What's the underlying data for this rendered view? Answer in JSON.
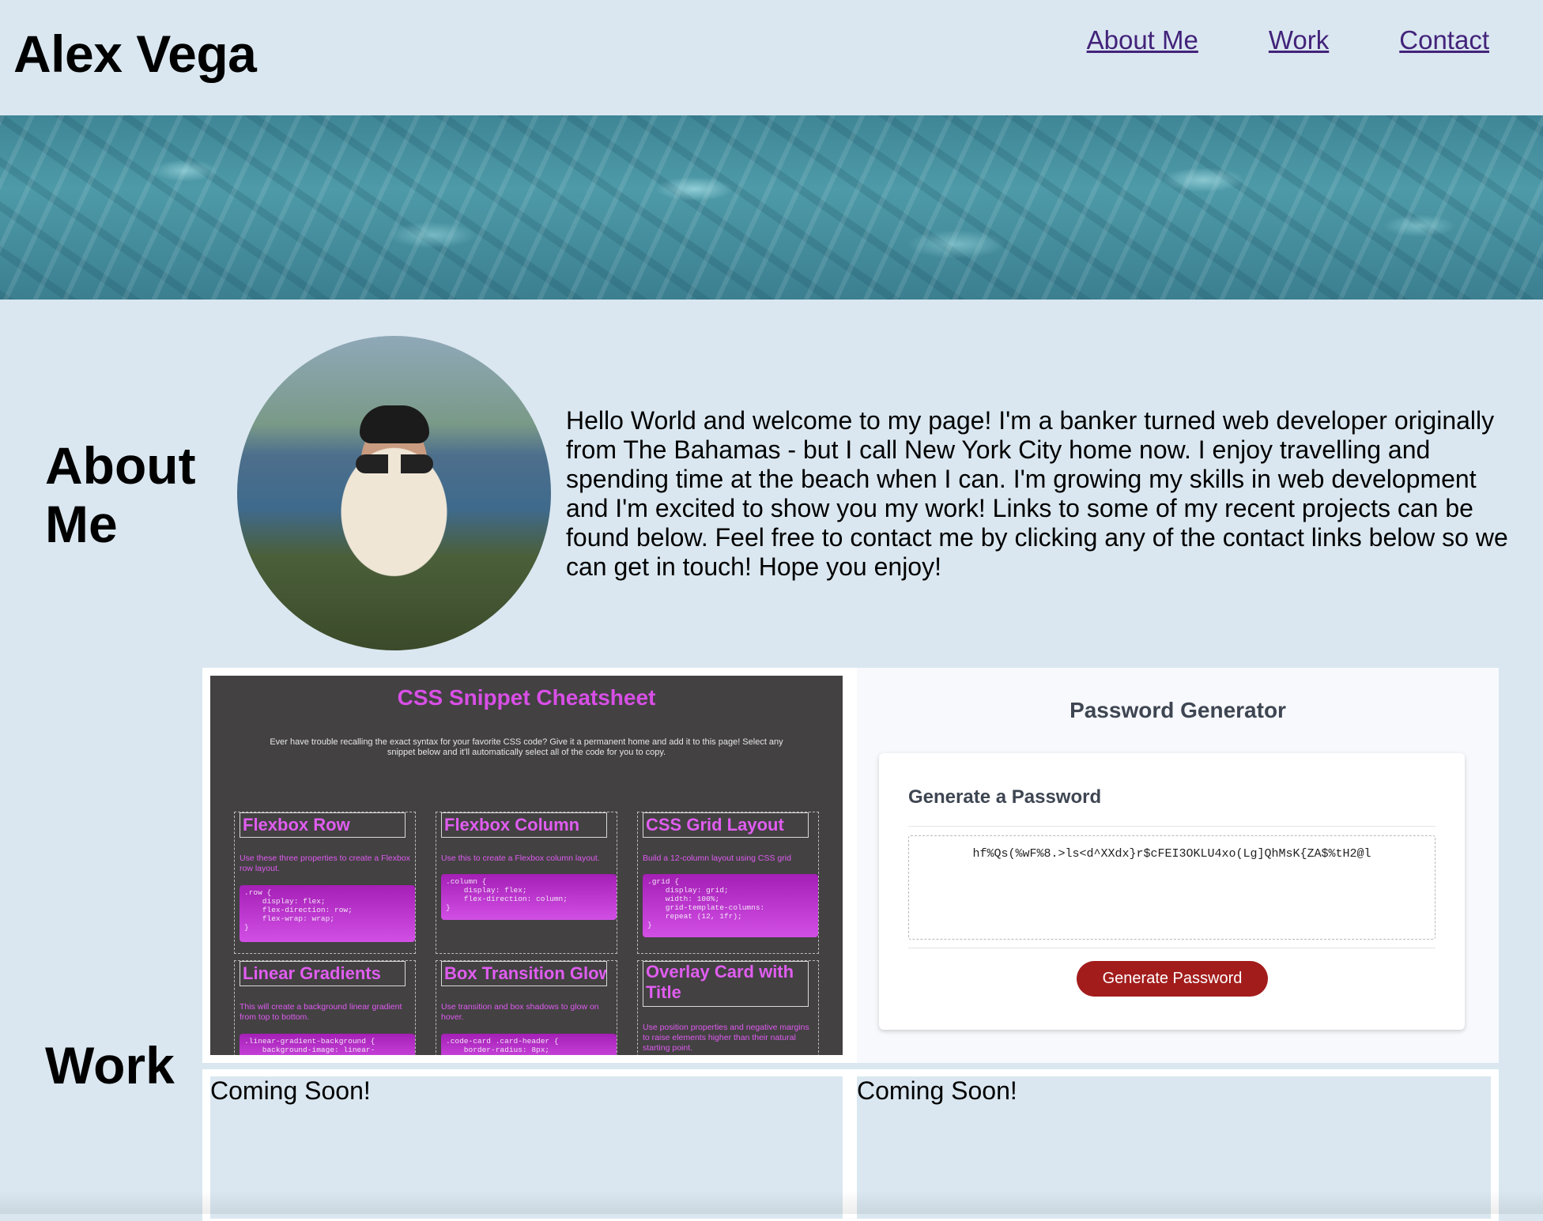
{
  "header": {
    "title": "Alex Vega",
    "nav": [
      "About Me",
      "Work",
      "Contact"
    ]
  },
  "about": {
    "heading": "About Me",
    "text": "Hello World and welcome to my page! I'm a banker turned web developer originally from The Bahamas - but I call New York City home now. I enjoy travelling and spending time at the beach when I can. I'm growing my skills in web development and I'm excited to show you my work! Links to some of my recent projects can be found below. Feel free to contact me by clicking any of the contact links below so we can get in touch! Hope you enjoy!"
  },
  "work": {
    "heading": "Work",
    "css_cheatsheet": {
      "title": "CSS Snippet Cheatsheet",
      "description": "Ever have trouble recalling the exact syntax for your favorite CSS code? Give it a permanent home and add it to this page! Select any snippet below and it'll automatically select all of the code for you to copy.",
      "snippets": [
        {
          "title": "Flexbox Row",
          "desc": "Use these three properties to create a Flexbox row layout.",
          "code": ".row {\n    display: flex;\n    flex-direction: row;\n    flex-wrap: wrap;\n}"
        },
        {
          "title": "Flexbox Column",
          "desc": "Use this to create a Flexbox column layout.",
          "code": ".column {\n    display: flex;\n    flex-direction: column;\n}"
        },
        {
          "title": "CSS Grid Layout",
          "desc": "Build a 12-column layout using CSS grid",
          "code": ".grid {\n    display: grid;\n    width: 100%;\n    grid-template-columns:\n    repeat (12, 1fr);\n}"
        },
        {
          "title": "Linear Gradients",
          "desc": "This will create a background linear gradient from top to bottom.",
          "code": ".linear-gradient-background {\n    background-image: linear-"
        },
        {
          "title": "Box Transition Glow",
          "desc": "Use transition and box shadows to glow on hover.",
          "code": ".code-card .card-header {\n    border-radius: 8px;"
        },
        {
          "title": "Overlay Card with Title",
          "desc": "Use position properties and negative margins to raise elements higher than their natural starting point.",
          "code": ""
        }
      ]
    },
    "password_generator": {
      "heading": "Password Generator",
      "subheading": "Generate a Password",
      "password": "hf%Qs(%wF%8.>ls<d^XXdx}r$cFEI3OKLU4xo(Lg]QhMsK{ZA$%tH2@l",
      "button_label": "Generate Password"
    },
    "coming_soon": [
      "Coming Soon!",
      "Coming Soon!"
    ]
  },
  "colors": {
    "background": "#dae7f0",
    "nav_link": "#43237a",
    "cheatsheet_accent": "#d84fe6",
    "generate_button": "#a31c1c"
  }
}
